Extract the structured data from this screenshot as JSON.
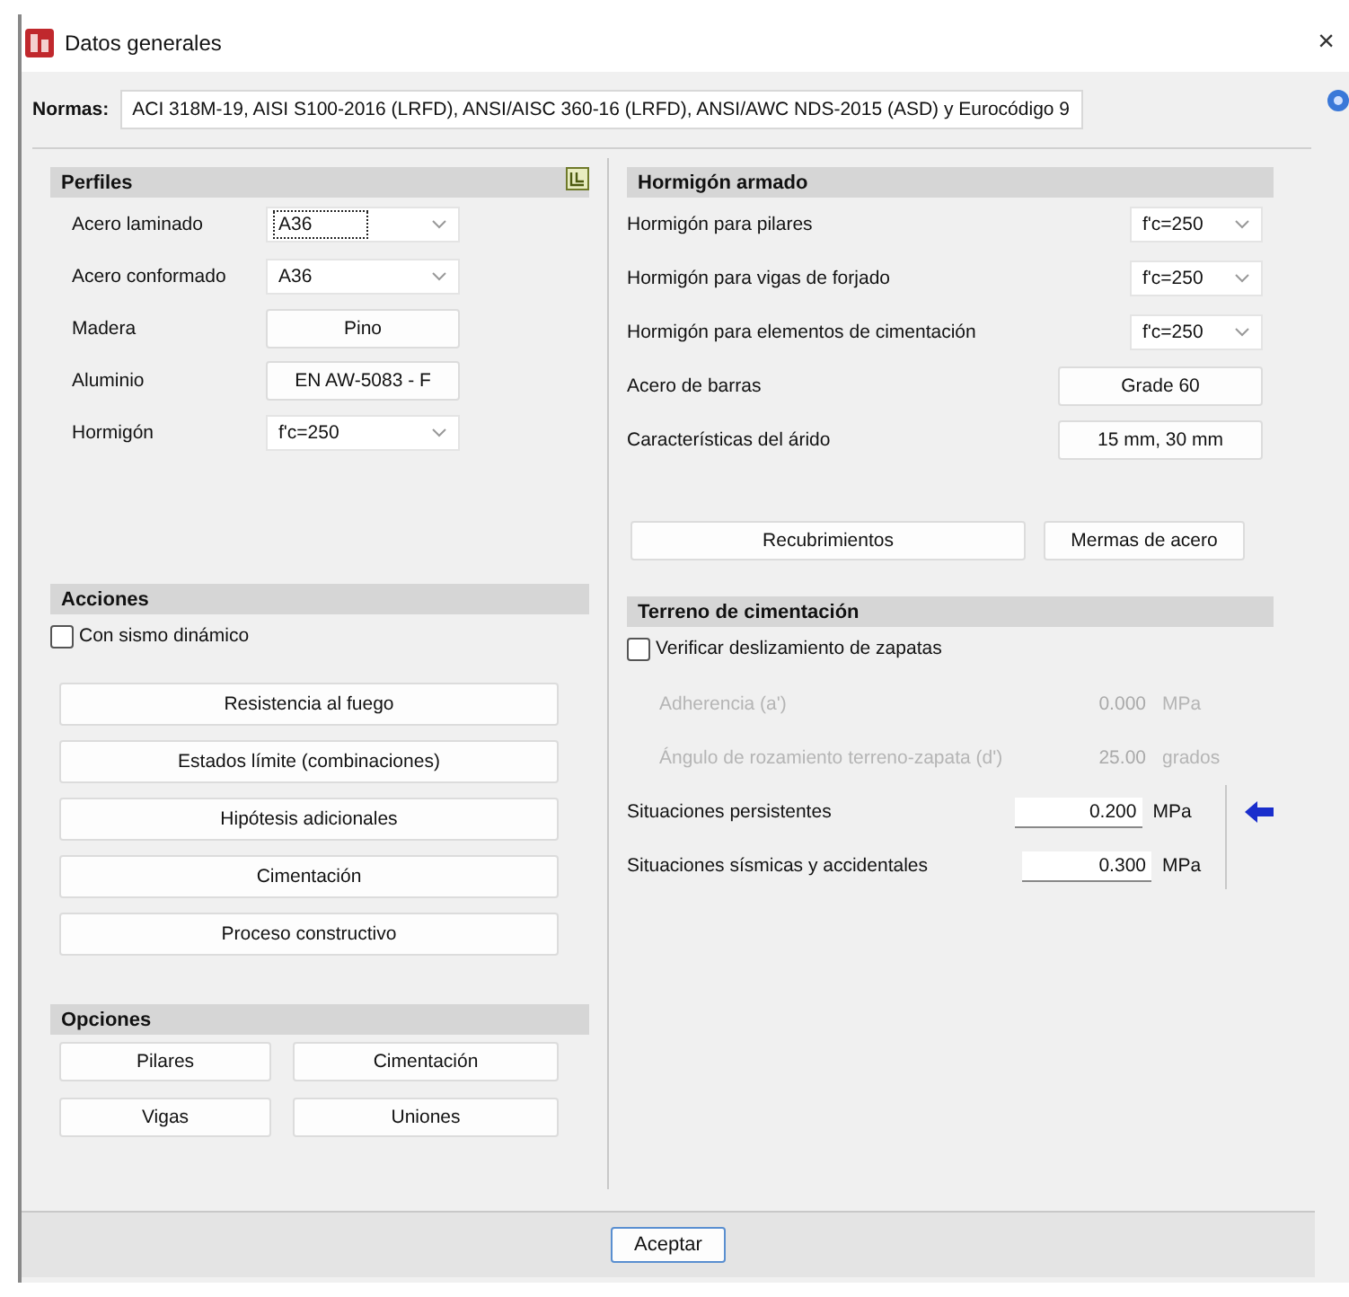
{
  "window": {
    "title": "Datos generales",
    "close": "×"
  },
  "normas": {
    "label": "Normas:",
    "value": "ACI 318M-19, AISI S100-2016 (LRFD), ANSI/AISC 360-16 (LRFD), ANSI/AWC NDS-2015 (ASD) y Eurocódigo 9"
  },
  "perfiles": {
    "title": "Perfiles",
    "rows": [
      {
        "label": "Acero laminado",
        "value": "A36",
        "kind": "select",
        "focused": true
      },
      {
        "label": "Acero conformado",
        "value": "A36",
        "kind": "select",
        "focused": false
      },
      {
        "label": "Madera",
        "value": "Pino",
        "kind": "button"
      },
      {
        "label": "Aluminio",
        "value": "EN AW-5083 - F",
        "kind": "button"
      },
      {
        "label": "Hormigón",
        "value": "f'c=250",
        "kind": "select",
        "focused": false
      }
    ]
  },
  "acciones": {
    "title": "Acciones",
    "checkbox": {
      "label": "Con sismo dinámico",
      "checked": false
    },
    "buttons": [
      "Resistencia al fuego",
      "Estados límite (combinaciones)",
      "Hipótesis adicionales",
      "Cimentación",
      "Proceso constructivo"
    ]
  },
  "opciones": {
    "title": "Opciones",
    "buttons": [
      "Pilares",
      "Cimentación",
      "Vigas",
      "Uniones"
    ]
  },
  "hormigon_armado": {
    "title": "Hormigón armado",
    "rows": [
      {
        "label": "Hormigón para pilares",
        "value": "f'c=250",
        "kind": "select"
      },
      {
        "label": "Hormigón para vigas de forjado",
        "value": "f'c=250",
        "kind": "select"
      },
      {
        "label": "Hormigón para elementos de cimentación",
        "value": "f'c=250",
        "kind": "select"
      },
      {
        "label": "Acero de barras",
        "value": "Grade 60",
        "kind": "button"
      },
      {
        "label": "Características del árido",
        "value": "15 mm, 30 mm",
        "kind": "button"
      }
    ],
    "buttons": [
      "Recubrimientos",
      "Mermas de acero"
    ]
  },
  "terreno": {
    "title": "Terreno de cimentación",
    "checkbox": {
      "label": "Verificar deslizamiento de zapatas",
      "checked": false
    },
    "rows": [
      {
        "label": "Adherencia (a')",
        "value": "0.000",
        "unit": "MPa",
        "disabled": true
      },
      {
        "label": "Ángulo de rozamiento terreno-zapata (d')",
        "value": "25.00",
        "unit": "grados",
        "disabled": true
      },
      {
        "label": "Situaciones persistentes",
        "value": "0.200",
        "unit": "MPa",
        "disabled": false
      },
      {
        "label": "Situaciones sísmicas y accidentales",
        "value": "0.300",
        "unit": "MPa",
        "disabled": false
      }
    ]
  },
  "footer": {
    "button": "Aceptar"
  }
}
